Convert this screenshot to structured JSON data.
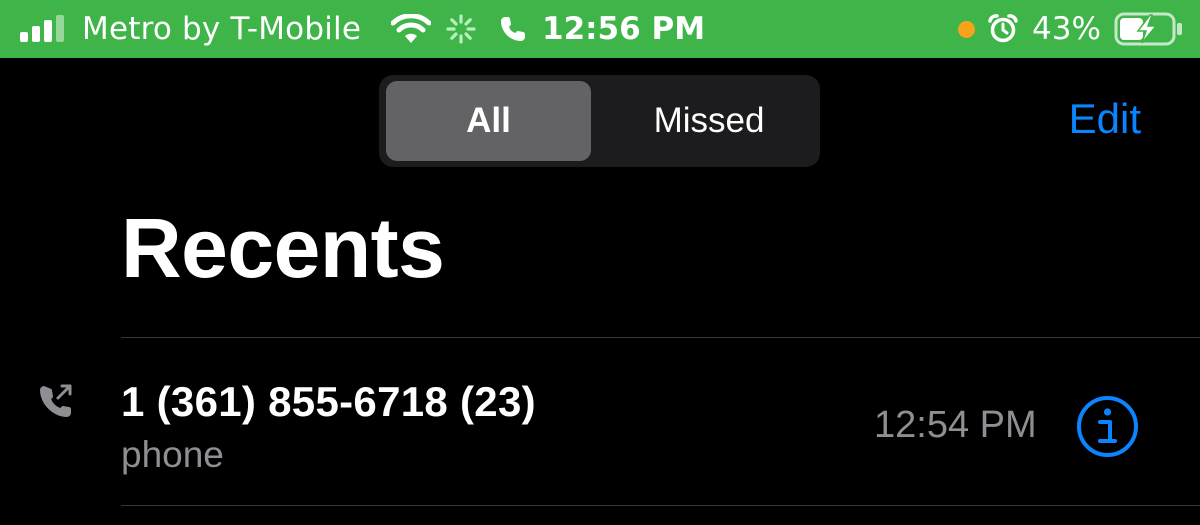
{
  "status_bar": {
    "carrier": "Metro by T-Mobile",
    "time": "12:56 PM",
    "battery_percent": "43%",
    "background_color": "#3fb449",
    "mic_indicator_color": "#f7a21b",
    "icons": [
      "signal-icon",
      "wifi-icon",
      "activity-spinner-icon",
      "phone-call-icon",
      "alarm-icon",
      "battery-charging-icon"
    ]
  },
  "header": {
    "segments": [
      {
        "label": "All",
        "selected": true
      },
      {
        "label": "Missed",
        "selected": false
      }
    ],
    "edit_label": "Edit",
    "accent_color": "#0a84ff"
  },
  "title": "Recents",
  "calls": [
    {
      "name": "1 (361) 855-6718 (23)",
      "type": "phone",
      "time": "12:54 PM",
      "direction_icon": "outgoing-call-icon",
      "info_icon": "info-icon"
    }
  ]
}
